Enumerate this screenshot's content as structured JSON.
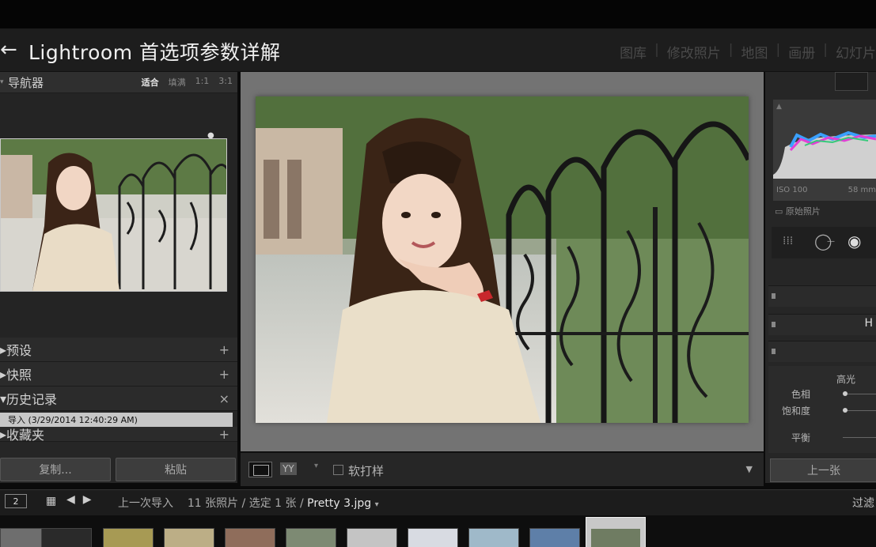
{
  "title": {
    "back_glyph": "←",
    "text": "Lightroom 首选项参数详解"
  },
  "modules": [
    "图库",
    "修改照片",
    "地图",
    "画册",
    "幻灯片"
  ],
  "navigator": {
    "label": "导航器",
    "options": [
      "适合",
      "填满",
      "1:1",
      "3:1"
    ],
    "selected": "适合"
  },
  "sections": {
    "presets": "预设",
    "snapshots": "快照",
    "history": "历史记录",
    "collections": "收藏夹"
  },
  "history_item": "导入 (3/29/2014 12:40:29 AM)",
  "left_buttons": {
    "copy": "复制...",
    "paste": "粘贴"
  },
  "toolbar": {
    "yy": "YY",
    "soft_proof": "软打样"
  },
  "histogram": {
    "iso": "ISO 100",
    "focal": "58 mm",
    "original": "原始照片"
  },
  "basic": {
    "highlights": "高光",
    "hue": "色相",
    "saturation": "饱和度",
    "balance": "平衡",
    "partial_h": "H"
  },
  "right_buttons": {
    "previous": "上一张"
  },
  "filmstrip": {
    "page": "2",
    "source": "上一次导入",
    "count": "11 张照片 / 选定 1 张 /",
    "filename": "Pretty 3.jpg",
    "filter": "过滤"
  },
  "colors": {
    "accent_bg": "#262626",
    "canvas": "#737373"
  }
}
